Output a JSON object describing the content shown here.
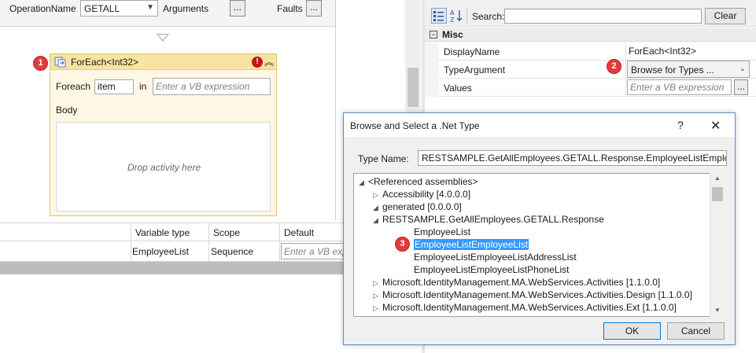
{
  "designer": {
    "operation_name_label": "OperationName",
    "operation_name_value": "GETALL",
    "arguments_label": "Arguments",
    "arguments_button": "...",
    "faults_label": "Faults",
    "faults_button": "...",
    "foreach": {
      "title": "ForEach<Int32>",
      "foreach_label": "Foreach",
      "item_value": "item",
      "in_label": "in",
      "expression_placeholder": "Enter a VB expression",
      "body_label": "Body",
      "drop_text": "Drop activity here"
    }
  },
  "variables_grid": {
    "headers": [
      "Variable type",
      "Scope",
      "Default"
    ],
    "row": {
      "type": "EmployeeList",
      "scope": "Sequence",
      "default_placeholder": "Enter a VB expression"
    }
  },
  "properties": {
    "search_label": "Search:",
    "search_value": "",
    "clear_button": "Clear",
    "category": "Misc",
    "rows": [
      {
        "name": "DisplayName",
        "value": "ForEach<Int32>"
      },
      {
        "name": "TypeArgument",
        "value": "Browse for Types ..."
      },
      {
        "name": "Values",
        "value": "Enter a VB expression",
        "button": "..."
      }
    ]
  },
  "dialog": {
    "title": "Browse and Select a .Net Type",
    "help": "?",
    "close": "✕",
    "type_name_label": "Type Name:",
    "type_name_value": "RESTSAMPLE.GetAllEmployees.GETALL.Response.EmployeeListEmployeeList",
    "tree": [
      {
        "label": "<Referenced assemblies>",
        "glyph": "◢",
        "level": 0
      },
      {
        "label": "Accessibility [4.0.0.0]",
        "glyph": "▷",
        "level": 1
      },
      {
        "label": "generated [0.0.0.0]",
        "glyph": "◢",
        "level": 1
      },
      {
        "label": "RESTSAMPLE.GetAllEmployees.GETALL.Response",
        "glyph": "◢",
        "level": 2
      },
      {
        "label": "EmployeeList",
        "glyph": "",
        "level": 3
      },
      {
        "label": "EmployeeListEmployeeList",
        "glyph": "",
        "level": 3,
        "selected": true
      },
      {
        "label": "EmployeeListEmployeeListAddressList",
        "glyph": "",
        "level": 3
      },
      {
        "label": "EmployeeListEmployeeListPhoneList",
        "glyph": "",
        "level": 3
      },
      {
        "label": "Microsoft.IdentityManagement.MA.WebServices.Activities [1.1.0.0]",
        "glyph": "▷",
        "level": 1
      },
      {
        "label": "Microsoft.IdentityManagement.MA.WebServices.Activities.Design [1.1.0.0]",
        "glyph": "▷",
        "level": 1
      },
      {
        "label": "Microsoft.IdentityManagement.MA.WebServices.Activities.Ext [1.1.0.0]",
        "glyph": "▷",
        "level": 1
      }
    ],
    "ok_button": "OK",
    "cancel_button": "Cancel"
  },
  "badges": [
    "1",
    "2",
    "3"
  ],
  "colors": {
    "accent": "#3399ff",
    "badge": "#e03c3c",
    "activity_header": "#f8e3a1",
    "error": "#c4161c"
  }
}
